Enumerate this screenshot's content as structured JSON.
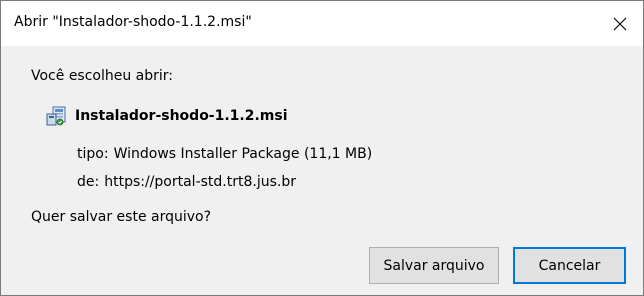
{
  "window": {
    "title": "Abrir \"Instalador-shodo-1.1.2.msi\"",
    "close_icon": "close-icon"
  },
  "dialog": {
    "intro": "Você escolheu abrir:",
    "file_icon": "msi-installer-icon",
    "file_name": "Instalador-shodo-1.1.2.msi",
    "type_label": "tipo:",
    "type_value": "Windows Installer Package (11,1 MB)",
    "from_label": "de:",
    "from_value": "https://portal-std.trt8.jus.br",
    "question": "Quer salvar este arquivo?"
  },
  "buttons": {
    "save_label": "Salvar arquivo",
    "cancel_label": "Cancelar"
  },
  "colors": {
    "focus_border": "#0078d7",
    "button_bg": "#e1e1e1",
    "dialog_bg": "#f0f0f0"
  }
}
